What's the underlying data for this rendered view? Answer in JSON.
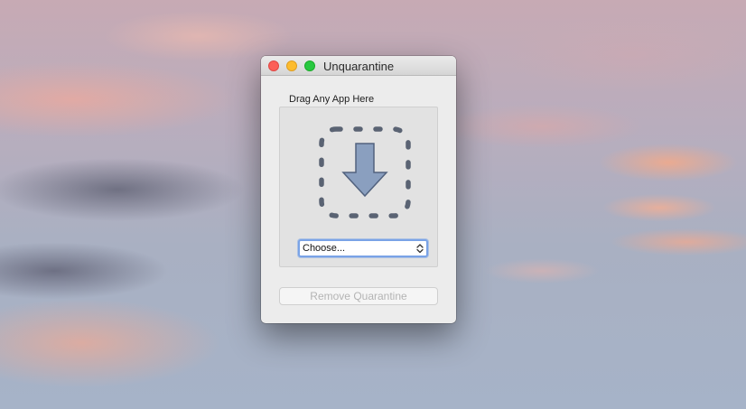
{
  "window": {
    "title": "Unquarantine"
  },
  "drop_zone": {
    "label": "Drag Any App Here",
    "icon": "download-arrow-icon",
    "arrow_color": "#8a9fbf"
  },
  "app_picker": {
    "selected": "Choose..."
  },
  "remove_button": {
    "label": "Remove Quarantine",
    "enabled": false
  },
  "colors": {
    "close": "#fc5f57",
    "minimize": "#fdbc2e",
    "zoom": "#28c840",
    "focus_ring": "#7aa3e6"
  }
}
